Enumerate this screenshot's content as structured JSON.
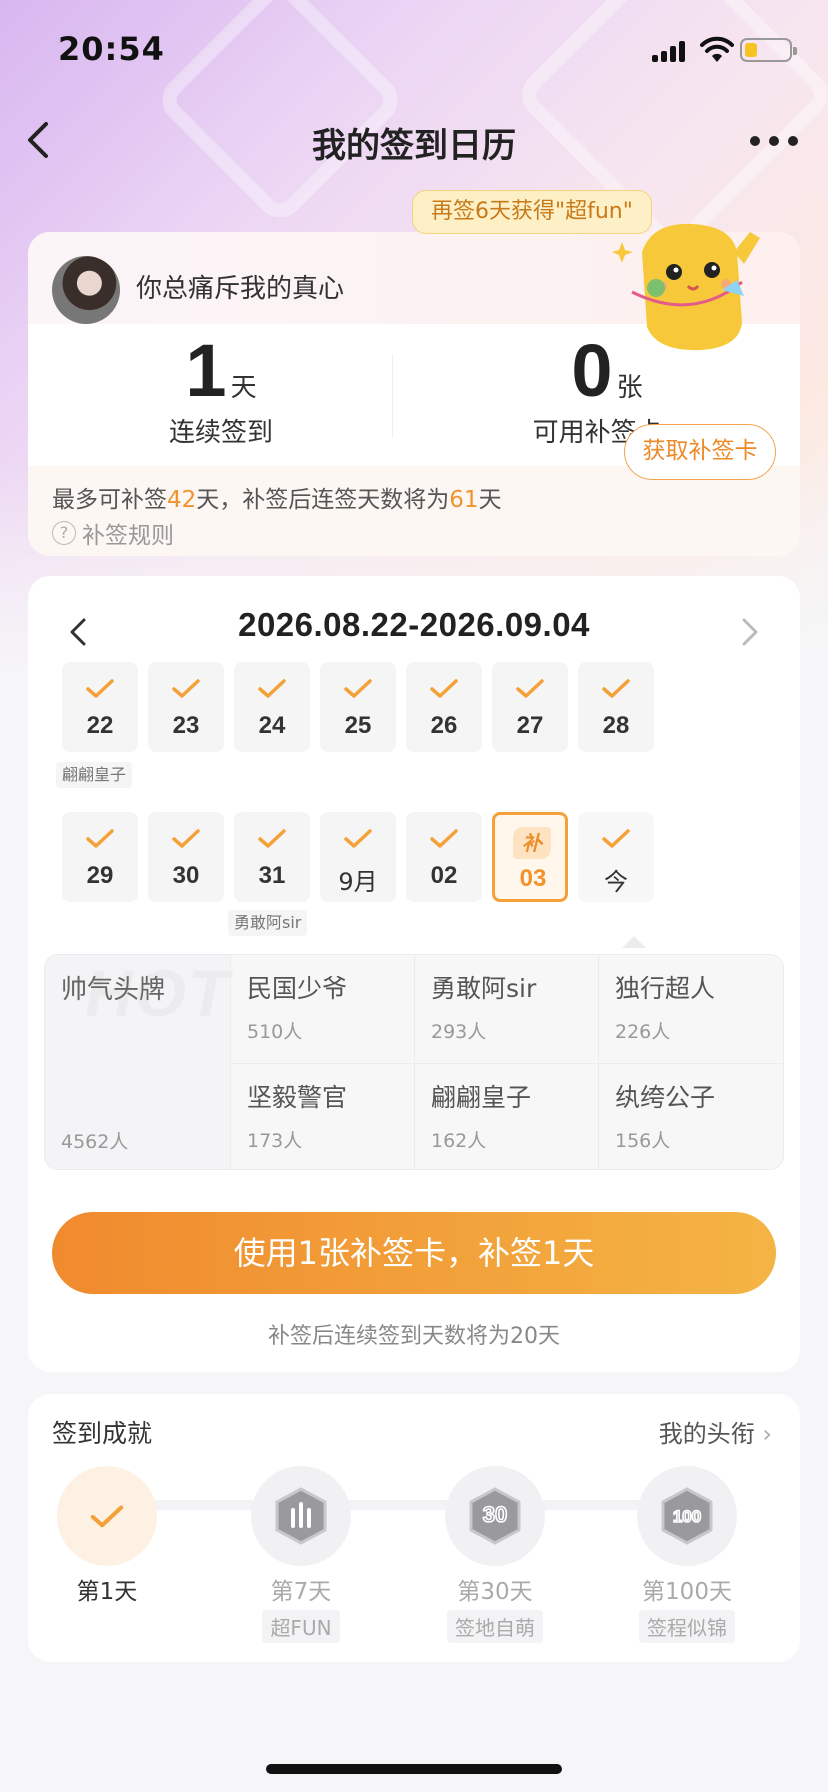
{
  "status_bar": {
    "time": "20:54"
  },
  "nav": {
    "title": "我的签到日历"
  },
  "tip": "再签6天获得\"超fun\"",
  "user": {
    "name": "你总痛斥我的真心"
  },
  "stats": [
    {
      "value": "1",
      "unit": "天",
      "label": "连续签到",
      "chevron": ""
    },
    {
      "value": "0",
      "unit": "张",
      "label": "可用补签卡",
      "chevron": "›"
    }
  ],
  "makeup": {
    "text_a": "最多可补签",
    "days_max": "42",
    "text_b": "天，补签后连签天数将为",
    "days_after": "61",
    "text_c": "天",
    "rules": "补签规则",
    "get_card_btn": "获取补签卡"
  },
  "calendar": {
    "range": "2026.08.22-2026.09.04",
    "week1": [
      {
        "num": "22",
        "checked": true,
        "title": "翩翩皇子"
      },
      {
        "num": "23",
        "checked": true,
        "title": ""
      },
      {
        "num": "24",
        "checked": true,
        "title": ""
      },
      {
        "num": "25",
        "checked": true,
        "title": ""
      },
      {
        "num": "26",
        "checked": true,
        "title": ""
      },
      {
        "num": "27",
        "checked": true,
        "title": ""
      },
      {
        "num": "28",
        "checked": true,
        "title": ""
      }
    ],
    "week2": [
      {
        "num": "29",
        "checked": true,
        "title": ""
      },
      {
        "num": "30",
        "checked": true,
        "title": ""
      },
      {
        "num": "31",
        "checked": true,
        "title": "勇敢阿sir"
      },
      {
        "num": "9月",
        "checked": true,
        "title": ""
      },
      {
        "num": "02",
        "checked": true,
        "title": ""
      },
      {
        "num": "03",
        "checked": false,
        "makeup_tag": "补",
        "selected": true,
        "title": ""
      },
      {
        "num": "今",
        "checked": true,
        "title": ""
      }
    ]
  },
  "titles": {
    "hot": {
      "name": "帅气头牌",
      "count": "4562人",
      "watermark": "HOT"
    },
    "items": [
      {
        "name": "民国少爷",
        "count": "510人"
      },
      {
        "name": "勇敢阿sir",
        "count": "293人"
      },
      {
        "name": "独行超人",
        "count": "226人"
      },
      {
        "name": "坚毅警官",
        "count": "173人"
      },
      {
        "name": "翩翩皇子",
        "count": "162人"
      },
      {
        "name": "纨绔公子",
        "count": "156人"
      }
    ]
  },
  "makeup_button": "使用1张补签卡，补签1天",
  "makeup_note": "补签后连续签到天数将为20天",
  "achievements": {
    "title": "签到成就",
    "link": "我的头衔",
    "items": [
      {
        "label": "第1天",
        "sub": "",
        "done": true,
        "icon": "check-icon"
      },
      {
        "label": "第7天",
        "sub": "超FUN",
        "done": false,
        "icon": "rock-hand-badge-icon"
      },
      {
        "label": "第30天",
        "sub": "签地自萌",
        "done": false,
        "icon": "30-days-badge-icon",
        "badge_text": "30"
      },
      {
        "label": "第100天",
        "sub": "签程似锦",
        "done": false,
        "icon": "100-days-badge-icon",
        "badge_text": "100"
      }
    ]
  },
  "colors": {
    "accent": "#f2922d",
    "check": "#f5a13a",
    "bg": "#f6f6f8"
  }
}
